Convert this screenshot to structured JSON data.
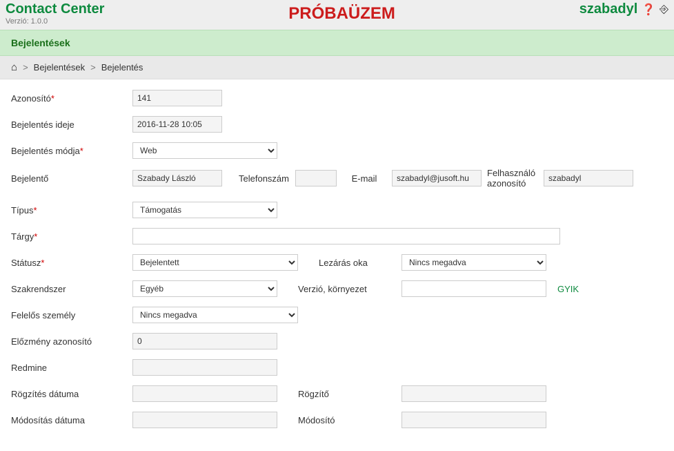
{
  "header": {
    "app_title": "Contact Center",
    "version_label": "Verzió: 1.0.0",
    "banner": "PRÓBAÜZEM",
    "username": "szabadyl"
  },
  "section_title": "Bejelentések",
  "breadcrumb": {
    "item1": "Bejelentések",
    "item2": "Bejelentés",
    "sep": ">"
  },
  "labels": {
    "azonosito": "Azonosító",
    "bejelentes_ideje": "Bejelentés ideje",
    "bejelentes_modja": "Bejelentés módja",
    "bejelento": "Bejelentő",
    "telefonszam": "Telefonszám",
    "email": "E-mail",
    "felhasznalo_azonosito": "Felhasználó azonosító",
    "tipus": "Típus",
    "targy": "Tárgy",
    "statusz": "Státusz",
    "lezaras_oka": "Lezárás oka",
    "szakrendszer": "Szakrendszer",
    "verzio_kornyezet": "Verzió, környezet",
    "gyik": "GYIK",
    "felelos_szemely": "Felelős személy",
    "elozmeny_azonosito": "Előzmény azonosító",
    "redmine": "Redmine",
    "rogzites_datuma": "Rögzítés dátuma",
    "rogzito": "Rögzítő",
    "modositas_datuma": "Módosítás dátuma",
    "modosito": "Módosító",
    "required": "*"
  },
  "values": {
    "azonosito": "141",
    "bejelentes_ideje": "2016-11-28 10:05",
    "bejelentes_modja": "Web",
    "bejelento": "Szabady László",
    "telefonszam": "",
    "email": "szabadyl@jusoft.hu",
    "felhasznalo_azonosito": "szabadyl",
    "tipus": "Támogatás",
    "targy": "",
    "statusz": "Bejelentett",
    "lezaras_oka": "Nincs megadva",
    "szakrendszer": "Egyéb",
    "verzio_kornyezet": "",
    "felelos_szemely": "Nincs megadva",
    "elozmeny_azonosito": "0",
    "redmine": "",
    "rogzites_datuma": "",
    "rogzito": "",
    "modositas_datuma": "",
    "modosito": ""
  }
}
